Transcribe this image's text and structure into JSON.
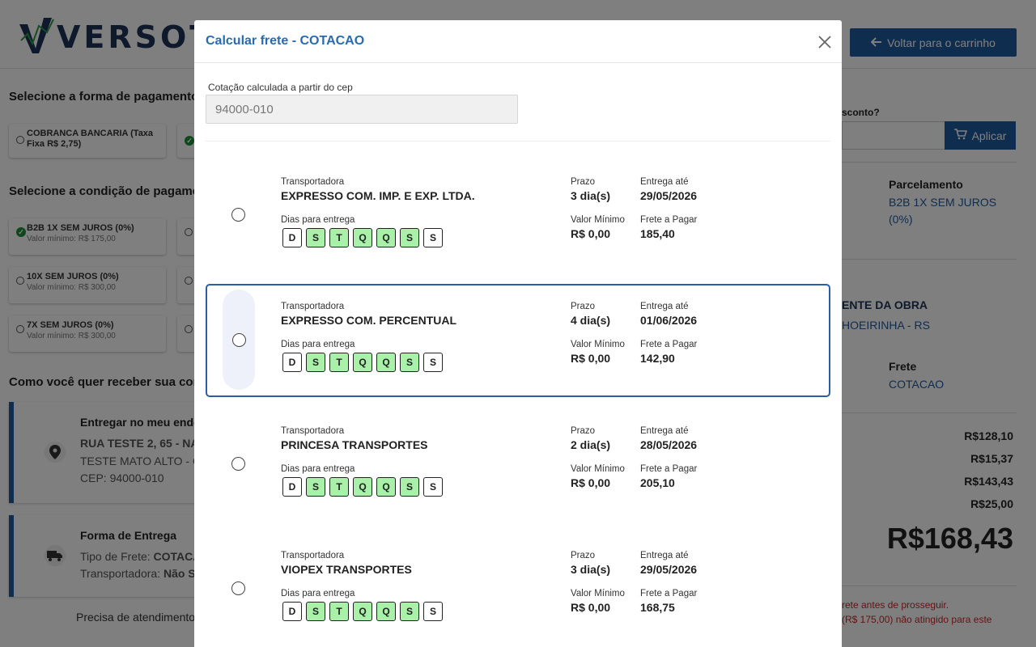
{
  "background": {
    "logo_text": "VERSOTEC",
    "back_button_label": "Voltar para o carrinho",
    "payment_section_title": "Selecione a forma de pagamento",
    "payment_options": [
      {
        "label": "COBRANCA BANCARIA (Taxa Fixa R$ 2,75)"
      }
    ],
    "condition_section_title": "Selecione a condição de pagamento",
    "conditions": [
      {
        "label": "B2B 1X SEM JUROS (0%)",
        "min": "Valor mínimo: R$ 175,00"
      },
      {
        "label": "10X SEM JUROS (0%)",
        "min": "Valor mínimo: R$ 300,00"
      },
      {
        "label": "7X SEM JUROS (0%)",
        "min": "Valor mínimo: R$ 300,00"
      }
    ],
    "delivery_section_title": "Como você quer receber sua comp",
    "address_card": {
      "title": "Entregar no meu ende",
      "line1": "RUA TESTE 2, 65 - NA",
      "line2": "TESTE MATO ALTO - CA",
      "line3": "CEP: 94000-010"
    },
    "shipping_card": {
      "title": "Forma de Entrega",
      "freight_type_label": "Tipo de Frete:",
      "freight_type_value": "COTACA",
      "carrier_label": "Transportadora:",
      "carrier_value": "Não S"
    },
    "help_text": "Precisa de atendimento",
    "coupon_question": "sconto?",
    "coupon_button": "Aplicar",
    "installments_title": "Parcelamento",
    "installments_value_line1": "B2B 1X SEM JUROS",
    "installments_value_line2": "(0%)",
    "address_right_title": "ENTE DA OBRA",
    "address_right_city": "HOEIRINHA - RS",
    "freight_title": "Frete",
    "freight_value": "COTACAO",
    "amounts": [
      "R$128,10",
      "R$15,37",
      "R$143,43",
      "R$25,00"
    ],
    "total": "R$168,43",
    "warning_line1": "rete antes de prosseguir.",
    "warning_line2": "(R$ 175,00) não atingido para este"
  },
  "modal": {
    "title": "Calcular frete - COTACAO",
    "cep_label": "Cotação calculada a partir do cep",
    "cep_value": "94000-010",
    "labels": {
      "carrier": "Transportadora",
      "delivery_days": "Dias para entrega",
      "term": "Prazo",
      "min_value": "Valor Mínimo",
      "delivery_until": "Entrega até",
      "freight_to_pay": "Frete a Pagar"
    },
    "days": [
      "D",
      "S",
      "T",
      "Q",
      "Q",
      "S",
      "S"
    ],
    "options": [
      {
        "carrier": "EXPRESSO COM. IMP. E EXP. LTDA.",
        "term": "3 dia(s)",
        "min_value": "R$ 0,00",
        "delivery_until": "29/05/2026",
        "freight": "185,40",
        "selected": false,
        "days_on": [
          false,
          true,
          true,
          true,
          true,
          true,
          false
        ]
      },
      {
        "carrier": "EXPRESSO COM. PERCENTUAL",
        "term": "4 dia(s)",
        "min_value": "R$ 0,00",
        "delivery_until": "01/06/2026",
        "freight": "142,90",
        "selected": true,
        "days_on": [
          false,
          true,
          true,
          true,
          true,
          true,
          false
        ]
      },
      {
        "carrier": "PRINCESA TRANSPORTES",
        "term": "2 dia(s)",
        "min_value": "R$ 0,00",
        "delivery_until": "28/05/2026",
        "freight": "205,10",
        "selected": false,
        "days_on": [
          false,
          true,
          true,
          true,
          true,
          true,
          false
        ]
      },
      {
        "carrier": "VIOPEX TRANSPORTES",
        "term": "3 dia(s)",
        "min_value": "R$ 0,00",
        "delivery_until": "29/05/2026",
        "freight": "168,75",
        "selected": false,
        "days_on": [
          false,
          true,
          true,
          true,
          true,
          true,
          false
        ]
      }
    ]
  }
}
